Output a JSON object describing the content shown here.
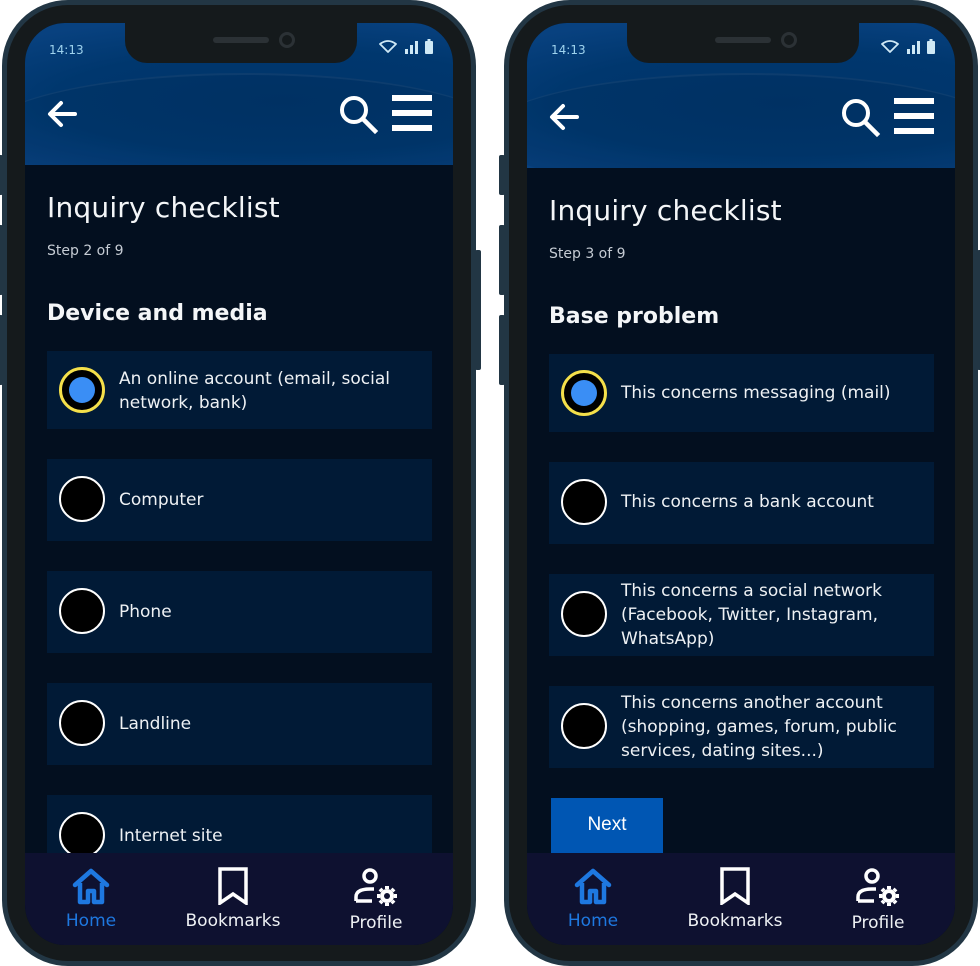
{
  "colors": {
    "header_bg": "#00376e",
    "content_bg": "#030f1f",
    "option_bg": "#011a36",
    "radio_checked_ring": "#f5e04a",
    "radio_checked_dot": "#3a8ef5",
    "accent_active_tab": "#1e78e0",
    "next_button_bg": "#0056b3",
    "tabbar_bg": "#0e1130"
  },
  "screens": [
    {
      "status": {
        "time": "14:13",
        "icons": [
          "wifi-icon",
          "signal-icon",
          "battery-icon"
        ]
      },
      "header": {
        "back_icon": "arrow-left-icon",
        "search_icon": "search-icon",
        "menu_icon": "hamburger-menu-icon"
      },
      "title": "Inquiry checklist",
      "step": "Step 2 of 9",
      "section": "Device and media",
      "options": [
        {
          "label": "An online account (email, social network, bank)",
          "checked": true
        },
        {
          "label": "Computer",
          "checked": false
        },
        {
          "label": "Phone",
          "checked": false
        },
        {
          "label": "Landline",
          "checked": false
        },
        {
          "label": "Internet site",
          "checked": false
        }
      ],
      "tabs": [
        {
          "label": "Home",
          "icon": "home-icon",
          "active": true
        },
        {
          "label": "Bookmarks",
          "icon": "bookmark-icon",
          "active": false
        },
        {
          "label": "Profile",
          "icon": "profile-settings-icon",
          "active": false
        }
      ]
    },
    {
      "status": {
        "time": "14:13",
        "icons": [
          "wifi-icon",
          "signal-icon",
          "battery-icon"
        ]
      },
      "header": {
        "back_icon": "arrow-left-icon",
        "search_icon": "search-icon",
        "menu_icon": "hamburger-menu-icon"
      },
      "title": "Inquiry checklist",
      "step": "Step 3 of 9",
      "section": "Base problem",
      "options": [
        {
          "label": "This concerns messaging (mail)",
          "checked": true
        },
        {
          "label": "This concerns a bank account",
          "checked": false
        },
        {
          "label": "This concerns a social network (Facebook, Twitter, Instagram, WhatsApp)",
          "checked": false
        },
        {
          "label": "This concerns another account (shopping, games, forum, public services, dating sites...)",
          "checked": false
        }
      ],
      "next_label": "Next",
      "tabs": [
        {
          "label": "Home",
          "icon": "home-icon",
          "active": true
        },
        {
          "label": "Bookmarks",
          "icon": "bookmark-icon",
          "active": false
        },
        {
          "label": "Profile",
          "icon": "profile-settings-icon",
          "active": false
        }
      ]
    }
  ]
}
